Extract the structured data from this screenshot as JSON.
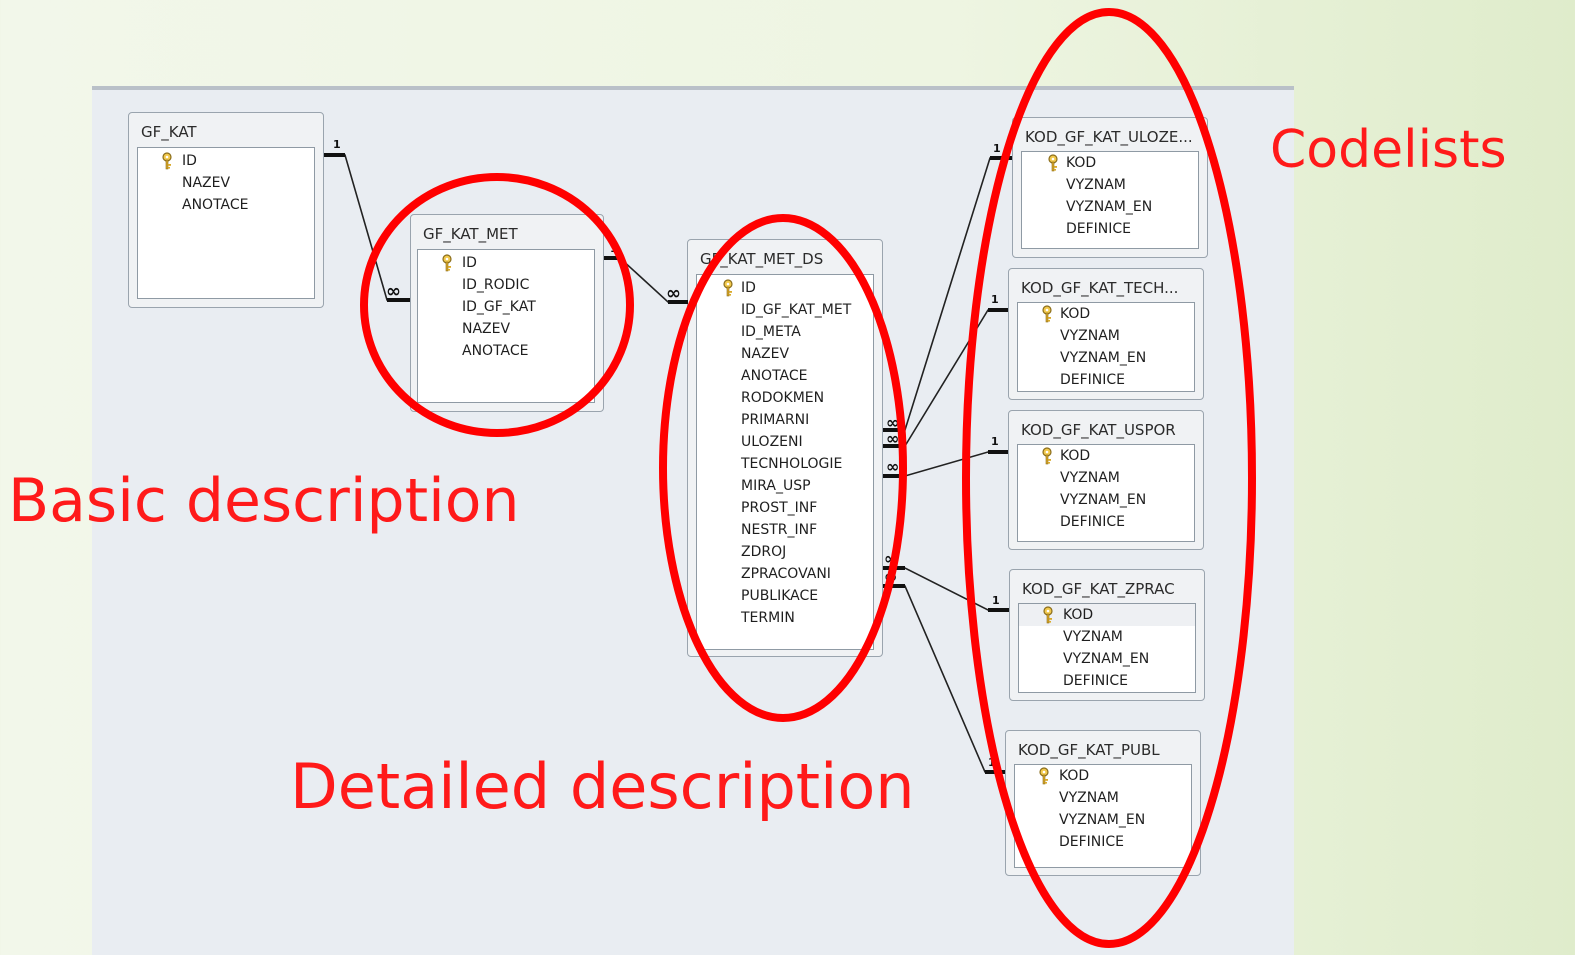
{
  "tables": {
    "gf_kat": {
      "name": "GF_KAT",
      "fields": [
        "ID",
        "NAZEV",
        "ANOTACE"
      ]
    },
    "gf_kat_met": {
      "name": "GF_KAT_MET",
      "fields": [
        "ID",
        "ID_RODIC",
        "ID_GF_KAT",
        "NAZEV",
        "ANOTACE"
      ]
    },
    "gf_kat_met_ds": {
      "name": "GF_KAT_MET_DS",
      "fields": [
        "ID",
        "ID_GF_KAT_MET",
        "ID_META",
        "NAZEV",
        "ANOTACE",
        "RODOKMEN",
        "PRIMARNI",
        "ULOZENI",
        "TECNHOLOGIE",
        "MIRA_USP",
        "PROST_INF",
        "NESTR_INF",
        "ZDROJ",
        "ZPRACOVANI",
        "PUBLIKACE",
        "TERMIN"
      ]
    },
    "kod_uloz": {
      "name": "KOD_GF_KAT_ULOZE...",
      "fields": [
        "KOD",
        "VYZNAM",
        "VYZNAM_EN",
        "DEFINICE"
      ]
    },
    "kod_tech": {
      "name": "KOD_GF_KAT_TECH...",
      "fields": [
        "KOD",
        "VYZNAM",
        "VYZNAM_EN",
        "DEFINICE"
      ]
    },
    "kod_uspor": {
      "name": "KOD_GF_KAT_USPOR",
      "fields": [
        "KOD",
        "VYZNAM",
        "VYZNAM_EN",
        "DEFINICE"
      ]
    },
    "kod_zprac": {
      "name": "KOD_GF_KAT_ZPRAC",
      "fields": [
        "KOD",
        "VYZNAM",
        "VYZNAM_EN",
        "DEFINICE"
      ]
    },
    "kod_publ": {
      "name": "KOD_GF_KAT_PUBL",
      "fields": [
        "KOD",
        "VYZNAM",
        "VYZNAM_EN",
        "DEFINICE"
      ]
    }
  },
  "cardinality": {
    "one": "1",
    "many": "∞"
  },
  "annotations": {
    "basic": "Basic description",
    "detailed": "Detailed description",
    "codelists": "Codelists"
  },
  "colors": {
    "annotation": "#ff1a1a",
    "line": "#222222"
  }
}
